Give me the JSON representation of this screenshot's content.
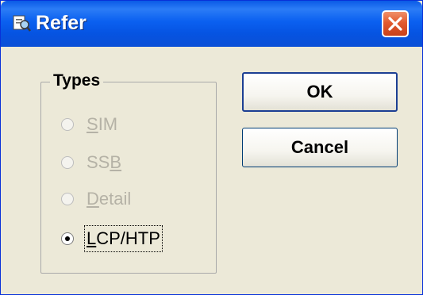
{
  "window": {
    "title": "Refer",
    "icon": "refer-app-icon",
    "close_icon": "close-icon"
  },
  "group": {
    "legend": "Types",
    "options": [
      {
        "underline": "S",
        "rest": "IM",
        "label": "SIM",
        "enabled": false,
        "checked": false
      },
      {
        "prefix": "SS",
        "underline": "B",
        "label": "SSB",
        "enabled": false,
        "checked": false
      },
      {
        "underline": "D",
        "rest": "etail",
        "label": "Detail",
        "enabled": false,
        "checked": false
      },
      {
        "underline": "L",
        "rest": "CP/HTP",
        "label": "LCP/HTP",
        "enabled": true,
        "checked": true
      }
    ]
  },
  "buttons": {
    "ok": "OK",
    "cancel": "Cancel"
  },
  "colors": {
    "title_bar": "#0a5ae6",
    "dialog_bg": "#ece9d8",
    "close_button": "#e25a2e",
    "disabled_text": "#b5b2a6"
  }
}
